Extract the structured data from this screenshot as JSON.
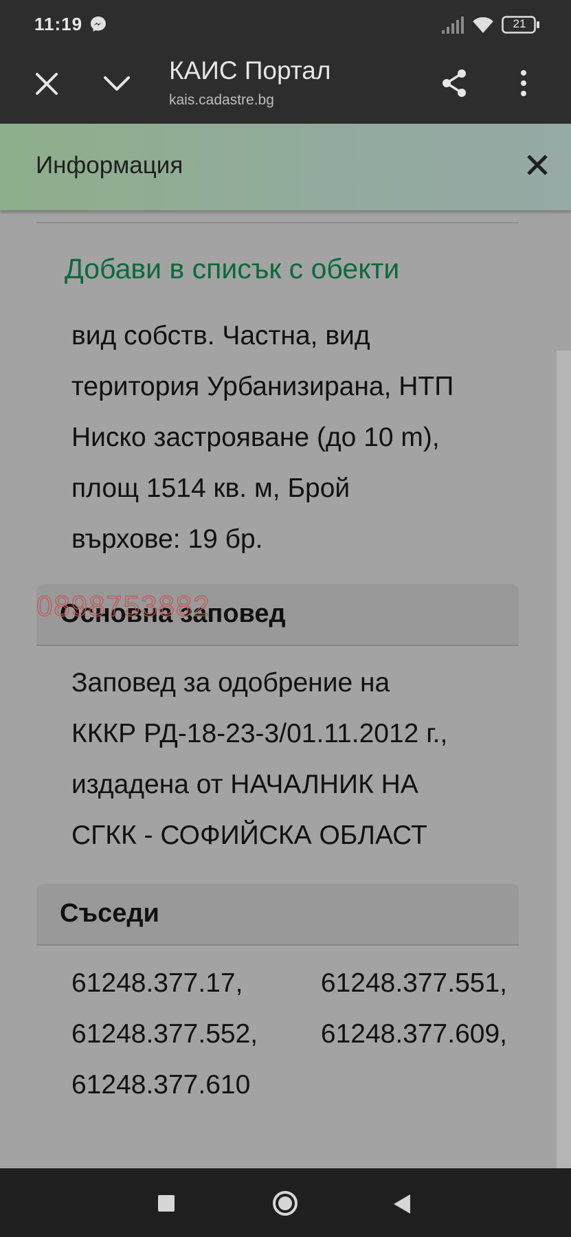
{
  "status_bar": {
    "time": "11:19",
    "battery": "21"
  },
  "toolbar": {
    "title": "КАИС Портал",
    "url": "kais.cadastre.bg"
  },
  "info": {
    "title": "Информация"
  },
  "add_link": "Добави в списък с обекти",
  "property_paragraph": [
    "вид собств. Частна, вид",
    "територия Урбанизирана, НТП",
    "Ниско застрояване (до 10 m),",
    "площ 1514 кв. м, Брой",
    "върхове: 19 бр."
  ],
  "watermark": "0898753882",
  "order_section": {
    "heading": "Основна заповед",
    "lines": [
      "Заповед за одобрение на",
      "КККР РД-18-23-3/01.11.2012 г.,",
      "издадена от НАЧАЛНИК НА",
      "СГКК - СОФИЙСКА ОБЛАСТ"
    ]
  },
  "neighbors_section": {
    "heading": "Съседи",
    "items": [
      "61248.377.17,",
      "61248.377.551,",
      "61248.377.552,",
      "61248.377.609,",
      "61248.377.610"
    ]
  },
  "colors": {
    "toolbar_bg": "#2d2d2d",
    "header_gradient_start": "#8eaf8b",
    "link_green": "#0b6a3c",
    "watermark_red": "#c25a5a"
  }
}
